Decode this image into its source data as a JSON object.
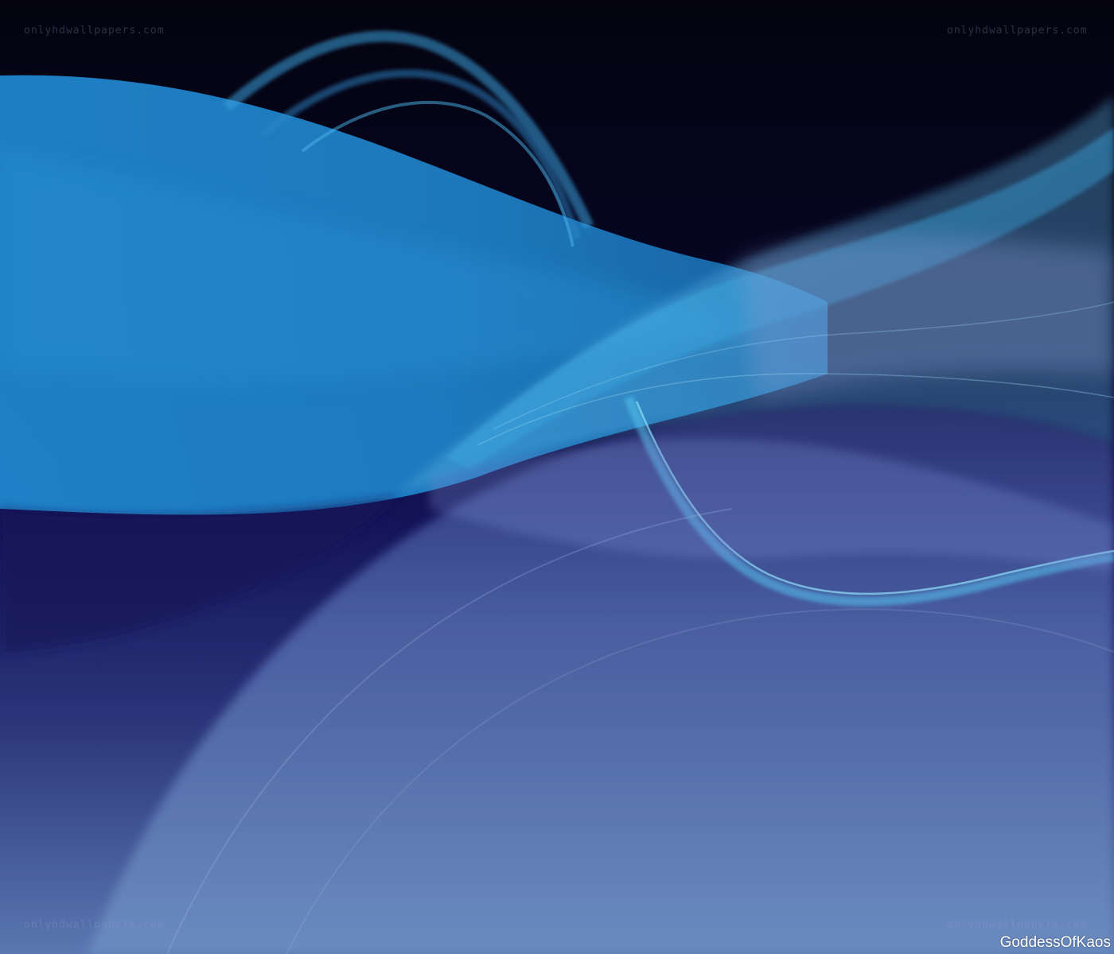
{
  "watermarks": {
    "top_left": "onlyhdwallpapers.com",
    "top_right": "onlyhdwallpapers.com",
    "bottom_left": "onlyhdwallpapers.com",
    "bottom_right": "onlyhdwallpapers.com"
  },
  "signature": "GoddessOfKaos",
  "colors": {
    "background_dark": "#050418",
    "navy": "#1b1a5e",
    "ribbon_blue": "#1f86c8",
    "highlight_cyan": "#5fd0f2",
    "lavender_lower": "#6b8cc0"
  }
}
